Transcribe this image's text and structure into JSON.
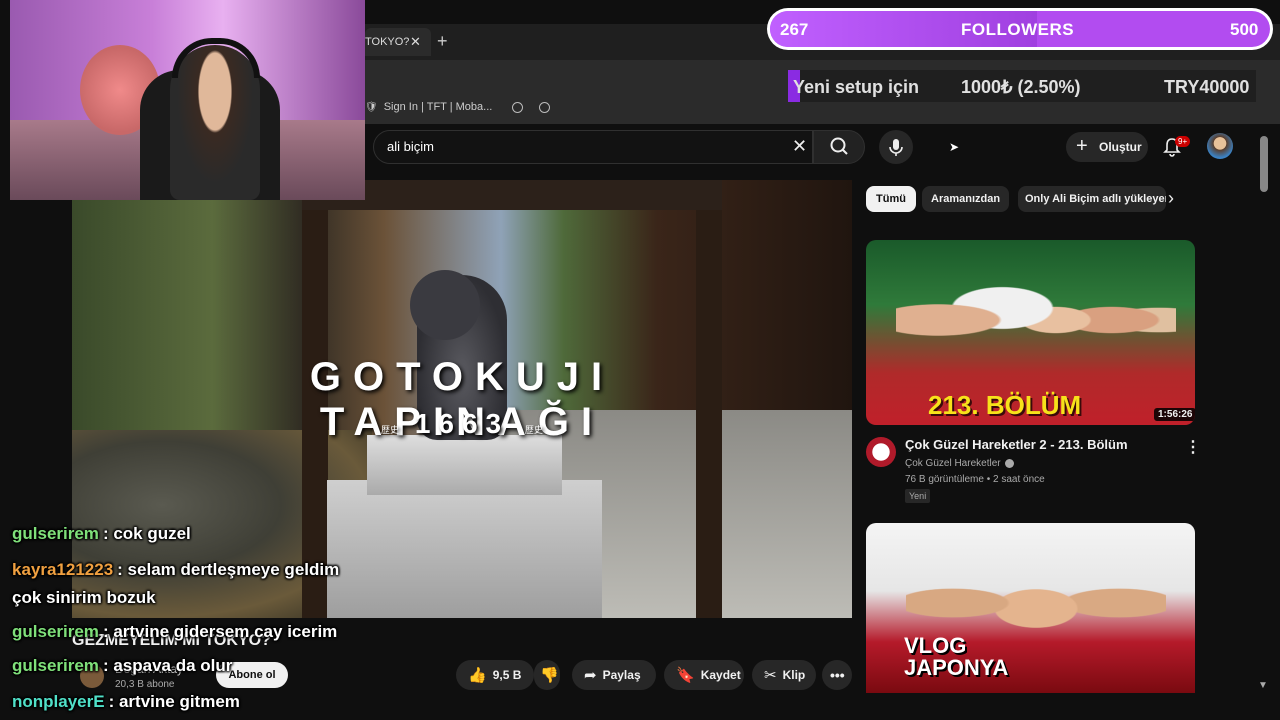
{
  "browser": {
    "tab_title": "TOKYO?",
    "tab_close": "✕",
    "new_tab": "+",
    "window_controls": [
      "—",
      "❐",
      "✕"
    ],
    "bookmark_label": "Sign In | TFT | Moba..."
  },
  "youtube": {
    "search_value": "ali biçim",
    "create_label": "Oluştur",
    "notification_count": "9+"
  },
  "video": {
    "overlay_title": "GOTOKUJI TAPINAĞI",
    "overlay_year": "1663",
    "overlay_kanji": "歴史",
    "title": "GEZMEYELİM Mİ TOKYO?",
    "channel_name": "Doğan Aktay",
    "subscribers": "20,3 B abone",
    "subscribe_label": "Abone ol",
    "likes": "9,5 B",
    "share_label": "Paylaş",
    "save_label": "Kaydet",
    "clip_label": "Klip"
  },
  "chips": [
    "Tümü",
    "Aramanızdan",
    "Only Ali Biçim adlı yükleyen"
  ],
  "recommendations": [
    {
      "thumb_text": "213. BÖLÜM",
      "duration": "1:56:26",
      "title": "Çok Güzel Hareketler 2 - 213. Bölüm",
      "channel": "Çok Güzel Hareketler",
      "views": "76 B görüntüleme",
      "age": "2 saat önce",
      "badge": "Yeni"
    },
    {
      "thumb_text": "VLOG JAPONYA"
    }
  ],
  "stream_overlay": {
    "followers_current": "267",
    "followers_label": "FOLLOWERS",
    "followers_goal": "500",
    "followers_progress": 0.534,
    "donation_label": "Yeni setup için",
    "donation_amount": "1000₺ (2.50%)",
    "donation_goal": "TRY40000",
    "donation_progress": 0.025,
    "chat": [
      {
        "user": "gulserirem",
        "color": "#7fe07a",
        "text": ": cok guzel"
      },
      {
        "user": "kayra121223",
        "color": "#f0a040",
        "text": ": selam dertleşmeye geldim"
      },
      {
        "user": "",
        "color": "#ffffff",
        "text": "çok sinirim bozuk"
      },
      {
        "user": "gulserirem",
        "color": "#7fe07a",
        "text": ": artvine gidersem cay icerim"
      },
      {
        "user": "gulserirem",
        "color": "#7fe07a",
        "text": ": aspava da olur"
      },
      {
        "user": "nonplayerE",
        "color": "#50e0c8",
        "text": ": artvine gitmem"
      }
    ]
  }
}
